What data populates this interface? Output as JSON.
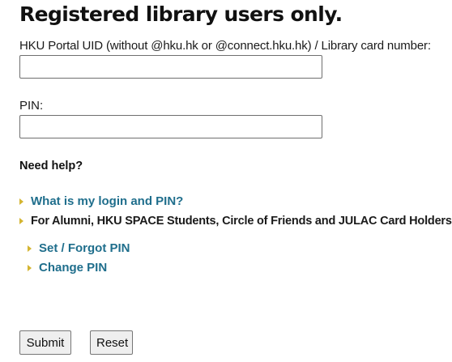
{
  "page": {
    "title": "Registered library users only."
  },
  "form": {
    "uid_label": "HKU Portal UID (without @hku.hk or @connect.hku.hk) / Library card number:",
    "uid_value": "",
    "pin_label": "PIN:",
    "pin_value": ""
  },
  "help": {
    "heading": "Need help?",
    "login_link": "What is my login and PIN?",
    "alumni_text": "For Alumni, HKU SPACE Students, Circle of Friends and JULAC Card Holders:",
    "set_forgot_pin_link": "Set / Forgot PIN",
    "change_pin_link": "Change PIN"
  },
  "buttons": {
    "submit_label": "Submit",
    "reset_label": "Reset"
  },
  "colors": {
    "link": "#1f6e8c",
    "bullet": "#d4b532"
  },
  "icons": {
    "bullet": "triangle-right-icon"
  }
}
